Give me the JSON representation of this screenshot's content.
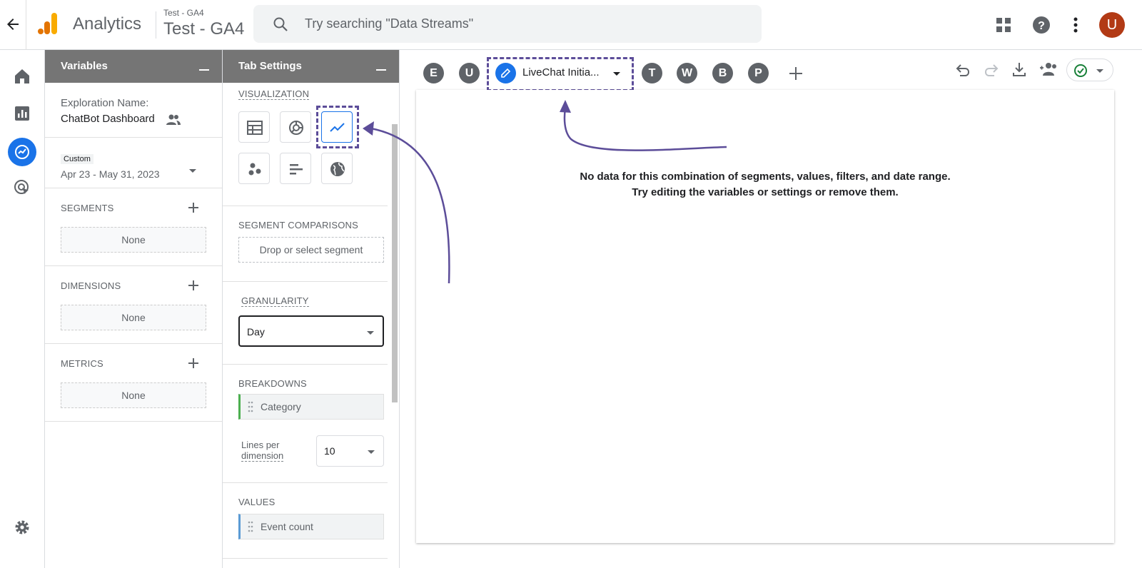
{
  "topbar": {
    "app_name": "Analytics",
    "property_small": "Test - GA4",
    "property_big": "Test - GA4",
    "search_placeholder": "Try searching \"Data Streams\"",
    "avatar_letter": "U"
  },
  "variables_panel": {
    "title": "Variables",
    "exploration_label": "Exploration Name:",
    "exploration_name": "ChatBot Dashboard",
    "date_tag": "Custom",
    "date_range": "Apr 23 - May 31, 2023",
    "segments_label": "SEGMENTS",
    "segments_value": "None",
    "dimensions_label": "DIMENSIONS",
    "dimensions_value": "None",
    "metrics_label": "METRICS",
    "metrics_value": "None"
  },
  "tab_settings": {
    "title": "Tab Settings",
    "visualization_label": "VISUALIZATION",
    "segment_comparisons_label": "SEGMENT COMPARISONS",
    "segment_drop": "Drop or select segment",
    "granularity_label": "GRANULARITY",
    "granularity_value": "Day",
    "breakdowns_label": "BREAKDOWNS",
    "breakdown_chip": "Category",
    "lines_label_1": "Lines per",
    "lines_label_2": "dimension",
    "lines_value": "10",
    "values_label": "VALUES",
    "values_chip": "Event count"
  },
  "tabs": {
    "items": [
      "E",
      "U",
      "T",
      "W",
      "B",
      "P"
    ],
    "active_label": "LiveChat Initia..."
  },
  "canvas": {
    "line1": "No data for this combination of segments, values, filters, and date range.",
    "line2": "Try editing the variables or settings or remove them."
  },
  "colors": {
    "accent": "#1a73e8",
    "annotation": "#5c4d99",
    "panel_header": "#757575",
    "avatar": "#b23a15"
  }
}
